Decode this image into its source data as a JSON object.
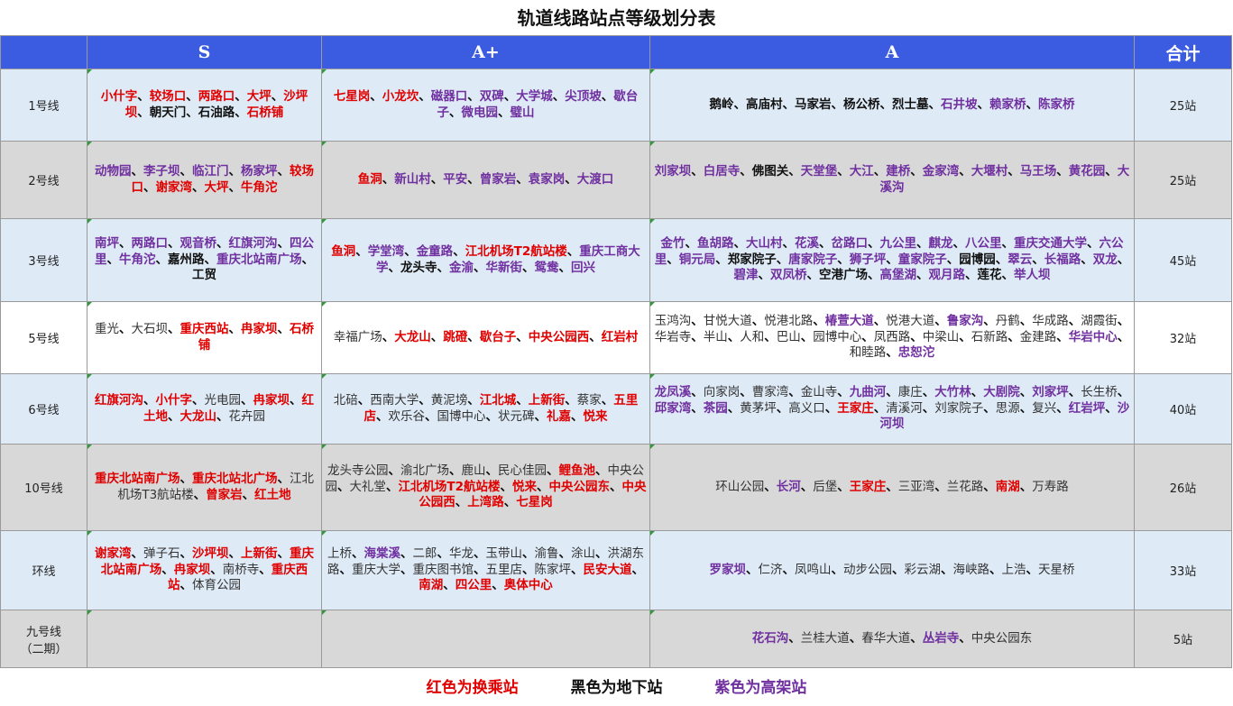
{
  "title": "轨道线路站点等级划分表",
  "headers": [
    "",
    "S",
    "A+",
    "A",
    "合计"
  ],
  "rows": [
    {
      "line": "1号线",
      "total": "25站",
      "s": [
        [
          "小什字",
          "r"
        ],
        [
          "较场口",
          "r"
        ],
        [
          "两路口",
          "r"
        ],
        [
          "大坪",
          "r"
        ],
        [
          "沙坪坝",
          "r"
        ],
        [
          "朝天门",
          "k"
        ],
        [
          "石油路",
          "k"
        ],
        [
          "石桥铺",
          "r"
        ]
      ],
      "ap": [
        [
          "七星岗",
          "r"
        ],
        [
          "小龙坎",
          "r"
        ],
        [
          "磁器口",
          "p"
        ],
        [
          "双碑",
          "p"
        ],
        [
          "大学城",
          "p"
        ],
        [
          "尖顶坡",
          "p"
        ],
        [
          "歇台子",
          "p"
        ],
        [
          "微电园",
          "p"
        ],
        [
          "璧山",
          "p"
        ]
      ],
      "a": [
        [
          "鹅岭",
          "k"
        ],
        [
          "高庙村",
          "k"
        ],
        [
          "马家岩",
          "k"
        ],
        [
          "杨公桥",
          "k"
        ],
        [
          "烈士墓",
          "k"
        ],
        [
          "石井坡",
          "p"
        ],
        [
          "赖家桥",
          "p"
        ],
        [
          "陈家桥",
          "p"
        ]
      ]
    },
    {
      "line": "2号线",
      "total": "25站",
      "s": [
        [
          "动物园",
          "p"
        ],
        [
          "李子坝",
          "p"
        ],
        [
          "临江门",
          "p"
        ],
        [
          "杨家坪",
          "p"
        ],
        [
          "较场口",
          "r"
        ],
        [
          "谢家湾",
          "r"
        ],
        [
          "大坪",
          "r"
        ],
        [
          "牛角沱",
          "r"
        ]
      ],
      "ap": [
        [
          "鱼洞",
          "r"
        ],
        [
          "新山村",
          "p"
        ],
        [
          "平安",
          "p"
        ],
        [
          "曾家岩",
          "p"
        ],
        [
          "袁家岗",
          "p"
        ],
        [
          "大渡口",
          "p"
        ]
      ],
      "a": [
        [
          "刘家坝",
          "p"
        ],
        [
          "白居寺",
          "p"
        ],
        [
          "佛图关",
          "k"
        ],
        [
          "天堂堡",
          "p"
        ],
        [
          "大江",
          "p"
        ],
        [
          "建桥",
          "p"
        ],
        [
          "金家湾",
          "p"
        ],
        [
          "大堰村",
          "p"
        ],
        [
          "马王场",
          "p"
        ],
        [
          "黄花园",
          "p"
        ],
        [
          "大溪沟",
          "p"
        ]
      ]
    },
    {
      "line": "3号线",
      "total": "45站",
      "s": [
        [
          "南坪",
          "p"
        ],
        [
          "两路口",
          "p"
        ],
        [
          "观音桥",
          "p"
        ],
        [
          "红旗河沟",
          "p"
        ],
        [
          "四公里",
          "p"
        ],
        [
          "牛角沱",
          "p"
        ],
        [
          "嘉州路",
          "k"
        ],
        [
          "重庆北站南广场",
          "p"
        ],
        [
          "工贸",
          "k"
        ]
      ],
      "ap": [
        [
          "鱼洞",
          "r"
        ],
        [
          "学堂湾",
          "p"
        ],
        [
          "金童路",
          "p"
        ],
        [
          "江北机场T2航站楼",
          "r"
        ],
        [
          "重庆工商大学",
          "p"
        ],
        [
          "龙头寺",
          "k"
        ],
        [
          "金渝",
          "p"
        ],
        [
          "华新街",
          "p"
        ],
        [
          "鸳鸯",
          "p"
        ],
        [
          "回兴",
          "p"
        ]
      ],
      "a": [
        [
          "金竹",
          "p"
        ],
        [
          "鱼胡路",
          "p"
        ],
        [
          "大山村",
          "p"
        ],
        [
          "花溪",
          "p"
        ],
        [
          "岔路口",
          "p"
        ],
        [
          "九公里",
          "p"
        ],
        [
          "麒龙",
          "p"
        ],
        [
          "八公里",
          "p"
        ],
        [
          "重庆交通大学",
          "p"
        ],
        [
          "六公里",
          "p"
        ],
        [
          "铜元局",
          "p"
        ],
        [
          "郑家院子",
          "k"
        ],
        [
          "唐家院子",
          "p"
        ],
        [
          "狮子坪",
          "p"
        ],
        [
          "童家院子",
          "p"
        ],
        [
          "园博园",
          "k"
        ],
        [
          "翠云",
          "p"
        ],
        [
          "长福路",
          "p"
        ],
        [
          "双龙",
          "p"
        ],
        [
          "碧津",
          "p"
        ],
        [
          "双凤桥",
          "p"
        ],
        [
          "空港广场",
          "k"
        ],
        [
          "高堡湖",
          "p"
        ],
        [
          "观月路",
          "p"
        ],
        [
          "莲花",
          "k"
        ],
        [
          "举人坝",
          "p"
        ]
      ]
    },
    {
      "line": "5号线",
      "total": "32站",
      "s": [
        [
          "重光",
          "n"
        ],
        [
          "大石坝",
          "n"
        ],
        [
          "重庆西站",
          "r"
        ],
        [
          "冉家坝",
          "r"
        ],
        [
          "石桥铺",
          "r"
        ]
      ],
      "ap": [
        [
          "幸福广场",
          "n"
        ],
        [
          "大龙山",
          "r"
        ],
        [
          "跳磴",
          "r"
        ],
        [
          "歇台子",
          "r"
        ],
        [
          "中央公园西",
          "r"
        ],
        [
          "红岩村",
          "r"
        ]
      ],
      "a": [
        [
          "玉鸿沟",
          "n"
        ],
        [
          "甘悦大道",
          "n"
        ],
        [
          "悦港北路",
          "n"
        ],
        [
          "椿萱大道",
          "p"
        ],
        [
          "悦港大道",
          "n"
        ],
        [
          "鲁家沟",
          "p"
        ],
        [
          "丹鹤",
          "n"
        ],
        [
          "华成路",
          "n"
        ],
        [
          "湖霞街",
          "n"
        ],
        [
          "华岩寺",
          "n"
        ],
        [
          "半山",
          "n"
        ],
        [
          "人和",
          "n"
        ],
        [
          "巴山",
          "n"
        ],
        [
          "园博中心",
          "n"
        ],
        [
          "凤西路",
          "n"
        ],
        [
          "中梁山",
          "n"
        ],
        [
          "石新路",
          "n"
        ],
        [
          "金建路",
          "n"
        ],
        [
          "华岩中心",
          "p"
        ],
        [
          "和睦路",
          "n"
        ],
        [
          "忠恕沱",
          "p"
        ]
      ]
    },
    {
      "line": "6号线",
      "total": "40站",
      "s": [
        [
          "红旗河沟",
          "r"
        ],
        [
          "小什字",
          "r"
        ],
        [
          "光电园",
          "n"
        ],
        [
          "冉家坝",
          "r"
        ],
        [
          "红土地",
          "r"
        ],
        [
          "大龙山",
          "r"
        ],
        [
          "花卉园",
          "n"
        ]
      ],
      "ap": [
        [
          "北碚",
          "n"
        ],
        [
          "西南大学",
          "n"
        ],
        [
          "黄泥塝",
          "n"
        ],
        [
          "江北城",
          "r"
        ],
        [
          "上新街",
          "r"
        ],
        [
          "蔡家",
          "n"
        ],
        [
          "五里店",
          "r"
        ],
        [
          "欢乐谷",
          "n"
        ],
        [
          "国博中心",
          "n"
        ],
        [
          "状元碑",
          "n"
        ],
        [
          "礼嘉",
          "r"
        ],
        [
          "悦来",
          "r"
        ]
      ],
      "a": [
        [
          "龙凤溪",
          "p"
        ],
        [
          "向家岗",
          "n"
        ],
        [
          "曹家湾",
          "n"
        ],
        [
          "金山寺",
          "n"
        ],
        [
          "九曲河",
          "p"
        ],
        [
          "康庄",
          "n"
        ],
        [
          "大竹林",
          "p"
        ],
        [
          "大剧院",
          "p"
        ],
        [
          "刘家坪",
          "p"
        ],
        [
          "长生桥",
          "n"
        ],
        [
          "邱家湾",
          "p"
        ],
        [
          "茶园",
          "p"
        ],
        [
          "黄茅坪",
          "n"
        ],
        [
          "高义口",
          "n"
        ],
        [
          "王家庄",
          "r"
        ],
        [
          "清溪河",
          "n"
        ],
        [
          "刘家院子",
          "n"
        ],
        [
          "思源",
          "n"
        ],
        [
          "复兴",
          "n"
        ],
        [
          "红岩坪",
          "p"
        ],
        [
          "沙河坝",
          "p"
        ]
      ]
    },
    {
      "line": "10号线",
      "total": "26站",
      "s": [
        [
          "重庆北站南广场",
          "r"
        ],
        [
          "重庆北站北广场",
          "r"
        ],
        [
          "江北机场T3航站楼",
          "n"
        ],
        [
          "曾家岩",
          "r"
        ],
        [
          "红土地",
          "r"
        ]
      ],
      "ap": [
        [
          "龙头寺公园",
          "n"
        ],
        [
          "渝北广场",
          "n"
        ],
        [
          "鹿山",
          "n"
        ],
        [
          "民心佳园",
          "n"
        ],
        [
          "鲤鱼池",
          "r"
        ],
        [
          "中央公园",
          "n"
        ],
        [
          "大礼堂",
          "n"
        ],
        [
          "江北机场T2航站楼",
          "r"
        ],
        [
          "悦来",
          "r"
        ],
        [
          "中央公园东",
          "r"
        ],
        [
          "中央公园西",
          "r"
        ],
        [
          "上湾路",
          "r"
        ],
        [
          "七星岗",
          "r"
        ]
      ],
      "a": [
        [
          "环山公园",
          "n"
        ],
        [
          "长河",
          "p"
        ],
        [
          "后堡",
          "n"
        ],
        [
          "王家庄",
          "r"
        ],
        [
          "三亚湾",
          "n"
        ],
        [
          "兰花路",
          "n"
        ],
        [
          "南湖",
          "r"
        ],
        [
          "万寿路",
          "n"
        ]
      ]
    },
    {
      "line": "环线",
      "total": "33站",
      "s": [
        [
          "谢家湾",
          "r"
        ],
        [
          "弹子石",
          "n"
        ],
        [
          "沙坪坝",
          "r"
        ],
        [
          "上新街",
          "r"
        ],
        [
          "重庆北站南广场",
          "r"
        ],
        [
          "冉家坝",
          "r"
        ],
        [
          "南桥寺",
          "n"
        ],
        [
          "重庆西站",
          "r"
        ],
        [
          "体育公园",
          "n"
        ]
      ],
      "ap": [
        [
          "上桥",
          "n"
        ],
        [
          "海棠溪",
          "p"
        ],
        [
          "二郎",
          "n"
        ],
        [
          "华龙",
          "n"
        ],
        [
          "玉带山",
          "n"
        ],
        [
          "渝鲁",
          "n"
        ],
        [
          "涂山",
          "n"
        ],
        [
          "洪湖东路",
          "n"
        ],
        [
          "重庆大学",
          "n"
        ],
        [
          "重庆图书馆",
          "n"
        ],
        [
          "五里店",
          "n"
        ],
        [
          "陈家坪",
          "n"
        ],
        [
          "民安大道",
          "r"
        ],
        [
          "南湖",
          "r"
        ],
        [
          "四公里",
          "r"
        ],
        [
          "奥体中心",
          "r"
        ]
      ],
      "a": [
        [
          "罗家坝",
          "p"
        ],
        [
          "仁济",
          "n"
        ],
        [
          "凤鸣山",
          "n"
        ],
        [
          "动步公园",
          "n"
        ],
        [
          "彩云湖",
          "n"
        ],
        [
          "海峡路",
          "n"
        ],
        [
          "上浩",
          "n"
        ],
        [
          "天星桥",
          "n"
        ]
      ]
    },
    {
      "line": "九号线\n（二期）",
      "total": "5站",
      "s": [],
      "ap": [],
      "a": [
        [
          "花石沟",
          "p"
        ],
        [
          "兰桂大道",
          "n"
        ],
        [
          "春华大道",
          "n"
        ],
        [
          "丛岩寺",
          "p"
        ],
        [
          "中央公园东",
          "n"
        ]
      ]
    }
  ],
  "legend": {
    "interchange": "红色为换乘站",
    "underground": "黑色为地下站",
    "elevated": "紫色为高架站",
    "colors": {
      "interchange": "#e00000",
      "underground": "#111111",
      "elevated": "#7030a0"
    }
  }
}
